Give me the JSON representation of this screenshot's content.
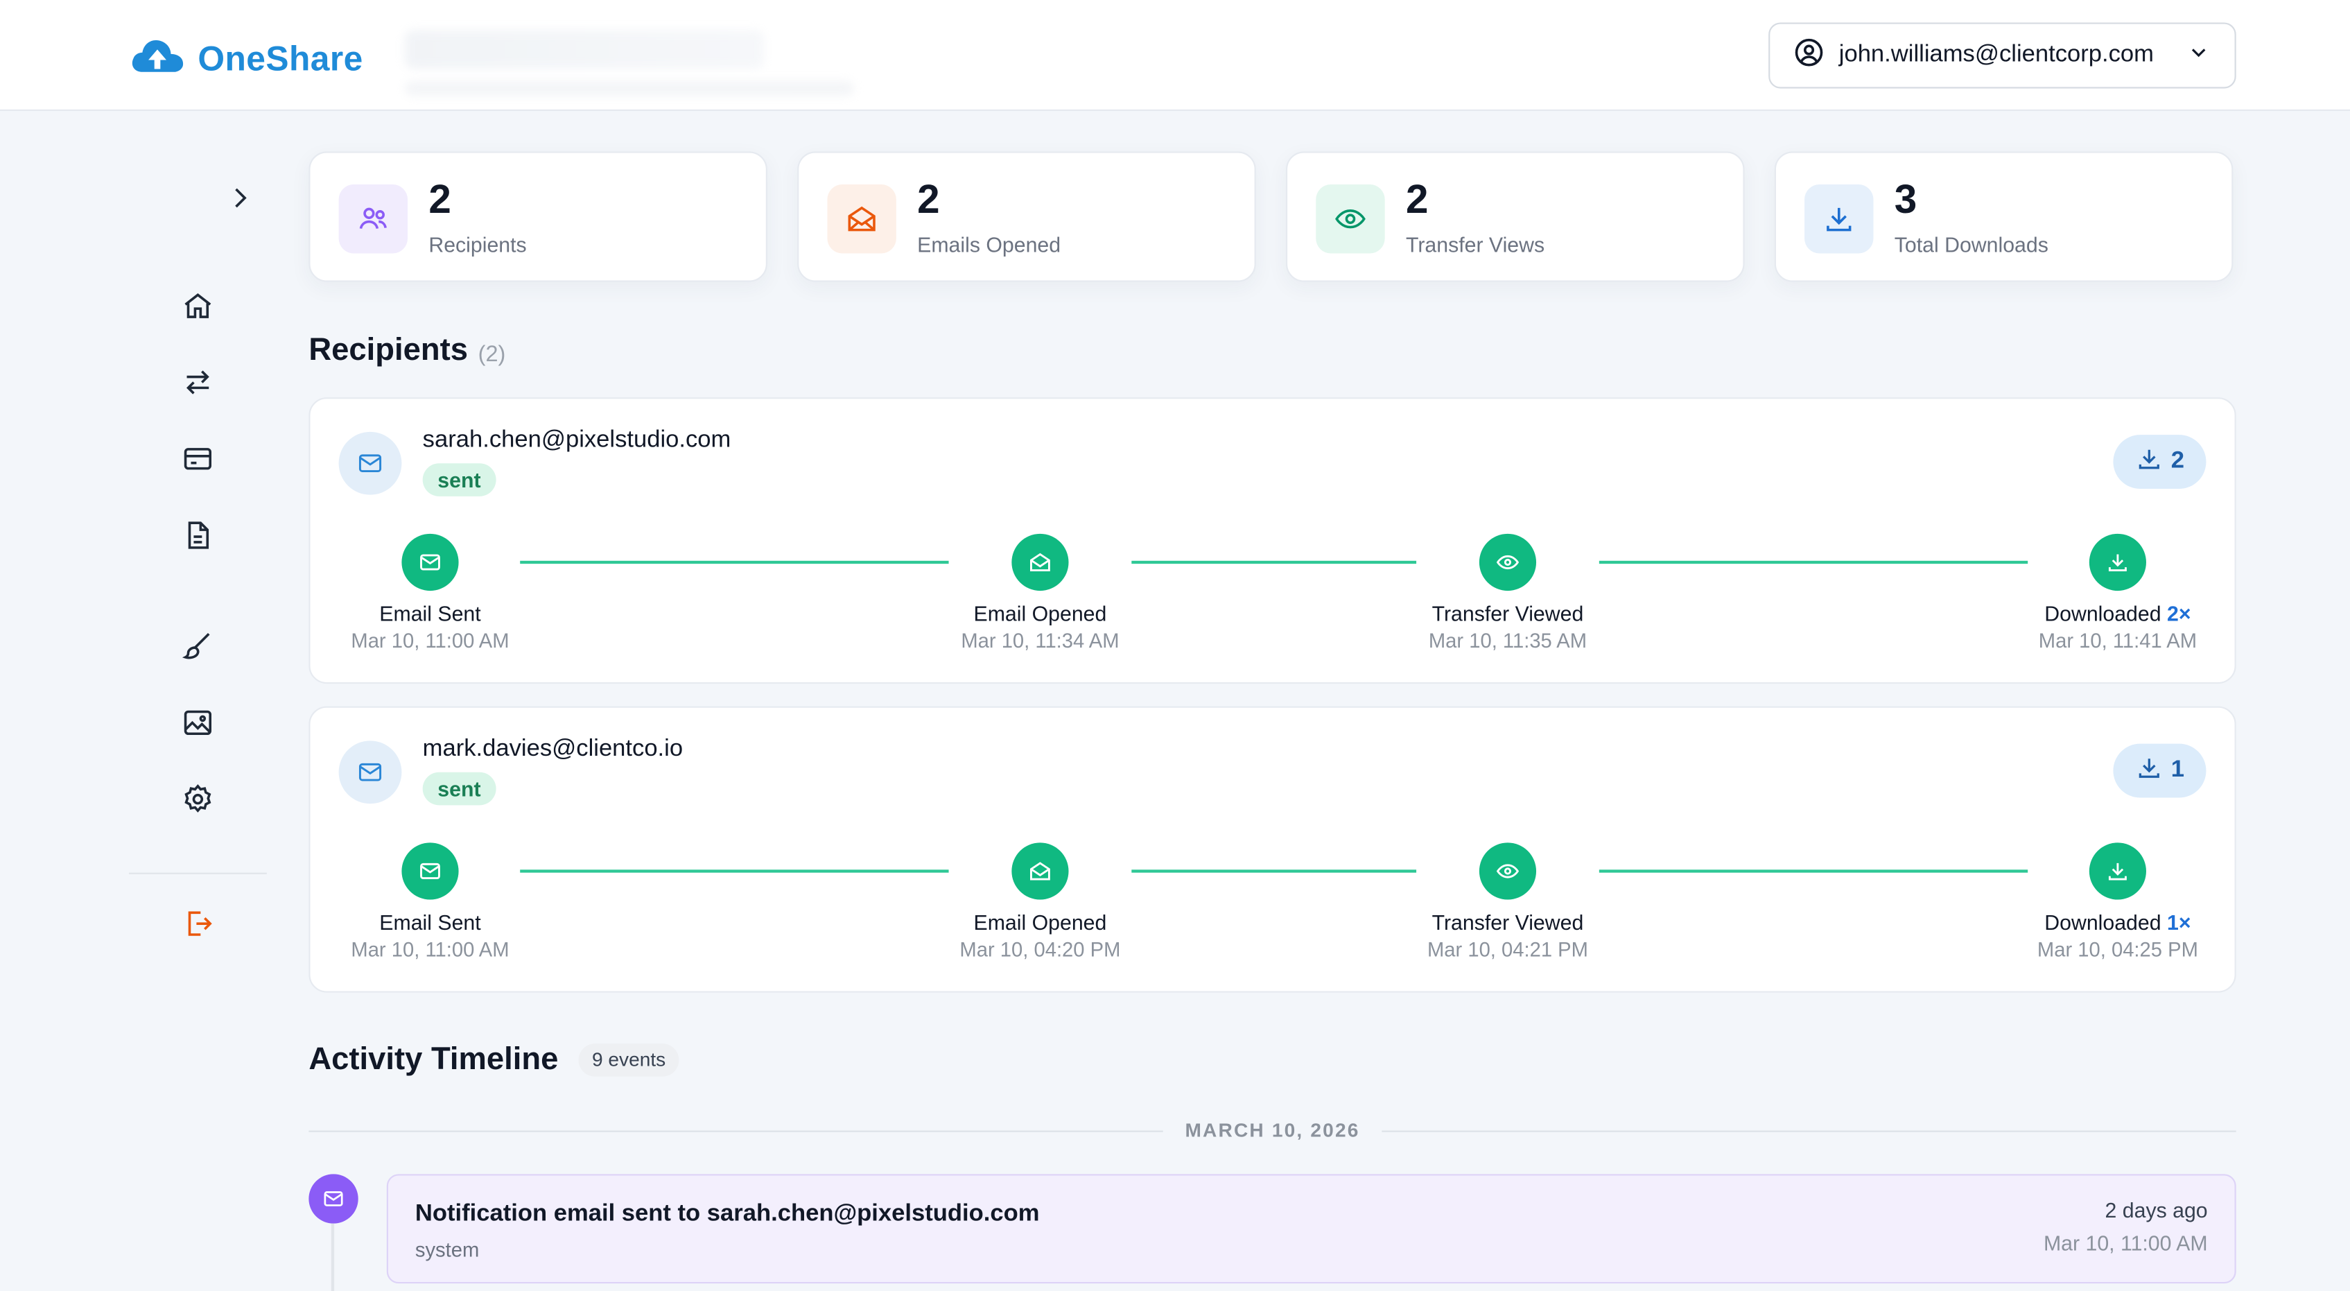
{
  "app": {
    "name": "OneShare"
  },
  "user": {
    "email": "john.williams@clientcorp.com"
  },
  "stats": [
    {
      "value": "2",
      "label": "Recipients",
      "icon": "users-icon",
      "color": "#8b5cf6",
      "bg": "#f1ecfd"
    },
    {
      "value": "2",
      "label": "Emails Opened",
      "icon": "mail-open-icon",
      "color": "#ea580c",
      "bg": "#fdf0e8"
    },
    {
      "value": "2",
      "label": "Transfer Views",
      "icon": "eye-icon",
      "color": "#059669",
      "bg": "#e4f7ef"
    },
    {
      "value": "3",
      "label": "Total Downloads",
      "icon": "download-icon",
      "color": "#1d6fd1",
      "bg": "#e6f0fb"
    }
  ],
  "recipients_section": {
    "title": "Recipients",
    "count": "(2)"
  },
  "recipients": [
    {
      "email": "sarah.chen@pixelstudio.com",
      "status": "sent",
      "downloads": "2",
      "steps": [
        {
          "label": "Email Sent",
          "time": "Mar 10, 11:00 AM",
          "icon": "mail-icon"
        },
        {
          "label": "Email Opened",
          "time": "Mar 10, 11:34 AM",
          "icon": "mail-open-icon"
        },
        {
          "label": "Transfer Viewed",
          "time": "Mar 10, 11:35 AM",
          "icon": "eye-icon"
        },
        {
          "label": "Downloaded",
          "time": "Mar 10, 11:41 AM",
          "icon": "download-icon",
          "mult": "2×"
        }
      ]
    },
    {
      "email": "mark.davies@clientco.io",
      "status": "sent",
      "downloads": "1",
      "steps": [
        {
          "label": "Email Sent",
          "time": "Mar 10, 11:00 AM",
          "icon": "mail-icon"
        },
        {
          "label": "Email Opened",
          "time": "Mar 10, 04:20 PM",
          "icon": "mail-open-icon"
        },
        {
          "label": "Transfer Viewed",
          "time": "Mar 10, 04:21 PM",
          "icon": "eye-icon"
        },
        {
          "label": "Downloaded",
          "time": "Mar 10, 04:25 PM",
          "icon": "download-icon",
          "mult": "1×"
        }
      ]
    }
  ],
  "timeline": {
    "title": "Activity Timeline",
    "count": "9 events",
    "date_group": "MARCH 10, 2026",
    "events": [
      {
        "title": "Notification email sent to sarah.chen@pixelstudio.com",
        "actor": "system",
        "relative": "2 days ago",
        "absolute": "Mar 10, 11:00 AM"
      }
    ]
  },
  "colors": {
    "brand": "#1f8bd8",
    "success": "#10b981",
    "event": "#8b5cf6"
  }
}
